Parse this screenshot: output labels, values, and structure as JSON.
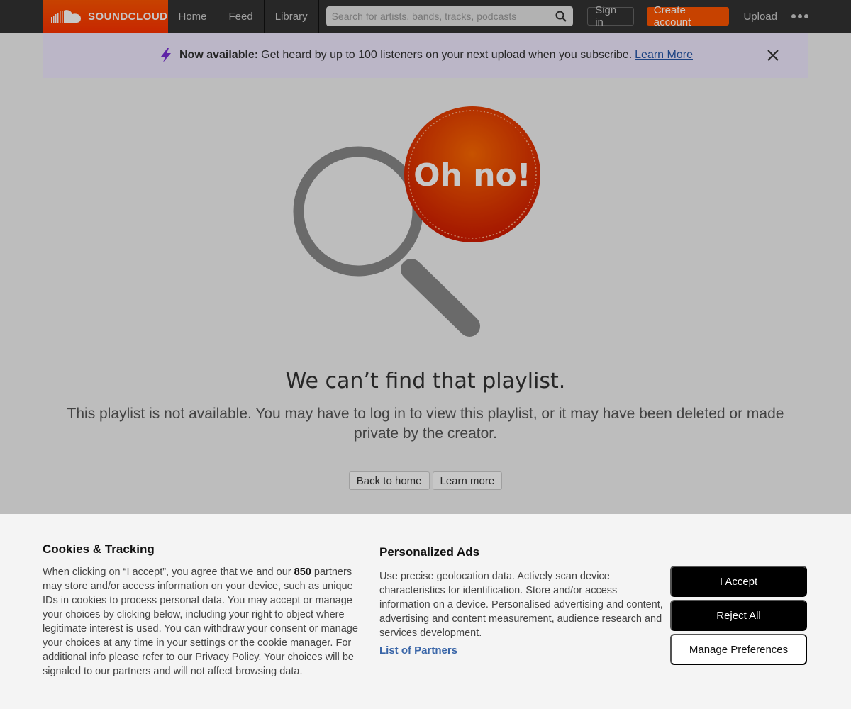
{
  "header": {
    "brand": "SOUNDCLOUD",
    "nav": [
      "Home",
      "Feed",
      "Library"
    ],
    "search_placeholder": "Search for artists, bands, tracks, podcasts",
    "signin": "Sign in",
    "create_account": "Create account",
    "upload": "Upload"
  },
  "banner": {
    "bold": "Now available:",
    "text": "Get heard by up to 100 listeners on your next upload when you subscribe.",
    "link": "Learn More"
  },
  "main": {
    "badge": "Oh no!",
    "headline": "We can’t find that playlist.",
    "subtext": "This playlist is not available. You may have to log in to view this playlist, or it may have been deleted or made private by the creator.",
    "back_home": "Back to home",
    "learn_more": "Learn more"
  },
  "cookie": {
    "title": "Cookies & Tracking",
    "body_pre": "When clicking on “I accept”, you agree that we and our",
    "partners_count": "850",
    "body_post": "partners may store and/or access information on your device, such as unique IDs in cookies to process personal data. You may accept or manage your choices by clicking below, including your right to object where legitimate interest is used. You can withdraw your consent or manage your choices at any time in your settings or the cookie manager. For additional info please refer to our Privacy Policy. Your choices will be signaled to our partners and will not affect browsing data.",
    "ads_title": "Personalized Ads",
    "ads_body": "Use precise geolocation data. Actively scan device characteristics for identification. Store and/or access information on a device. Personalised advertising and content, advertising and content measurement, audience research and services development.",
    "partners_link": "List of Partners",
    "accept": "I Accept",
    "reject": "Reject All",
    "manage": "Manage Preferences"
  },
  "colors": {
    "brand": "#ff5500",
    "topbar": "#333333",
    "banner_bg": "#f0eaff",
    "link": "#2456a8"
  }
}
